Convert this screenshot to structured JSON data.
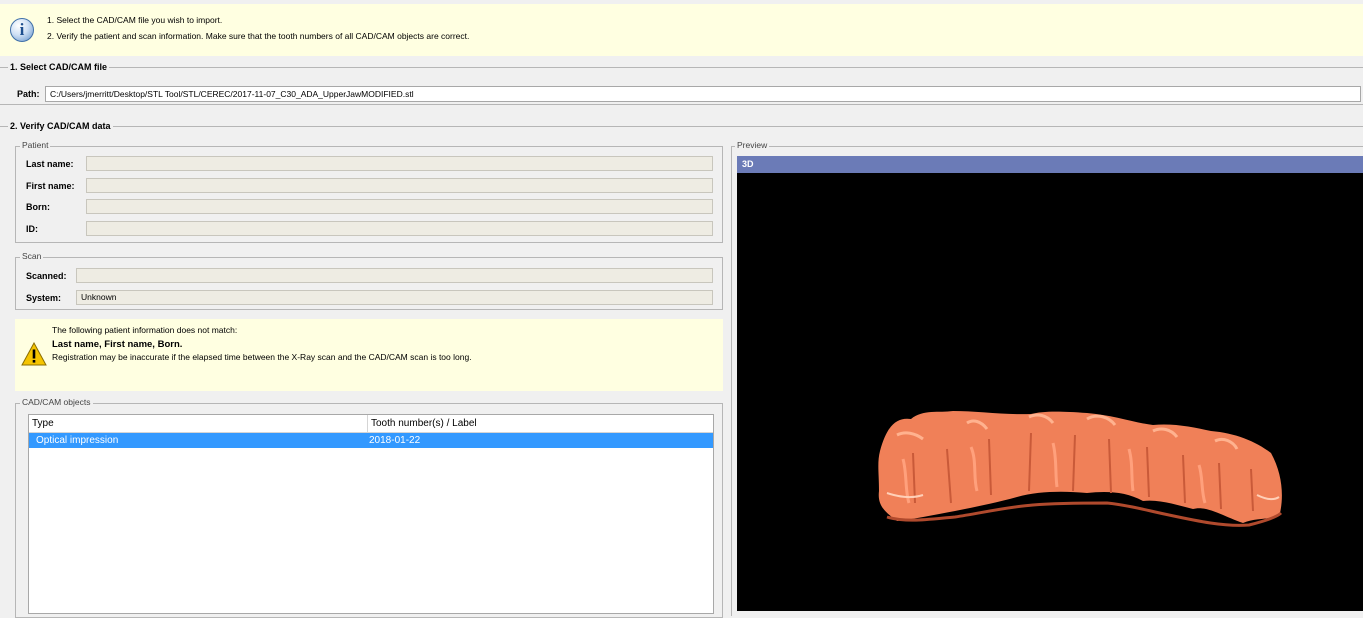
{
  "info": {
    "line1": "1. Select the CAD/CAM file you wish to import.",
    "line2": "2. Verify the patient and scan information. Make sure that the tooth numbers of all CAD/CAM objects are correct."
  },
  "section1": {
    "title": "1. Select CAD/CAM file",
    "path_label": "Path:",
    "path_value": "C:/Users/jmerritt/Desktop/STL Tool/STL/CEREC/2017-11-07_C30_ADA_UpperJawMODIFIED.stl"
  },
  "section2": {
    "title": "2. Verify CAD/CAM data",
    "patient": {
      "title": "Patient",
      "last_name_label": "Last name:",
      "last_name_value": "",
      "first_name_label": "First name:",
      "first_name_value": "",
      "born_label": "Born:",
      "born_value": "",
      "id_label": "ID:",
      "id_value": ""
    },
    "scan": {
      "title": "Scan",
      "scanned_label": "Scanned:",
      "scanned_value": "",
      "system_label": "System:",
      "system_value": "Unknown"
    },
    "warning": {
      "line1": "The following patient information does not match:",
      "line2": "Last name, First name, Born.",
      "line3": "Registration may be inaccurate if the elapsed time between the X-Ray scan and the CAD/CAM scan is too long."
    },
    "objects": {
      "title": "CAD/CAM objects",
      "columns": [
        "Type",
        "Tooth number(s) / Label"
      ],
      "rows": [
        {
          "type": "Optical impression",
          "label": "2018-01-22",
          "selected": true
        }
      ]
    },
    "preview": {
      "title": "Preview",
      "tab": "3D",
      "model_icon": "upper-jaw-3d-model",
      "model_color": "#f08058",
      "background": "#000000"
    }
  },
  "colors": {
    "info_background": "#ffffe1",
    "selection": "#3399ff",
    "preview_header": "#6b7bb7"
  }
}
